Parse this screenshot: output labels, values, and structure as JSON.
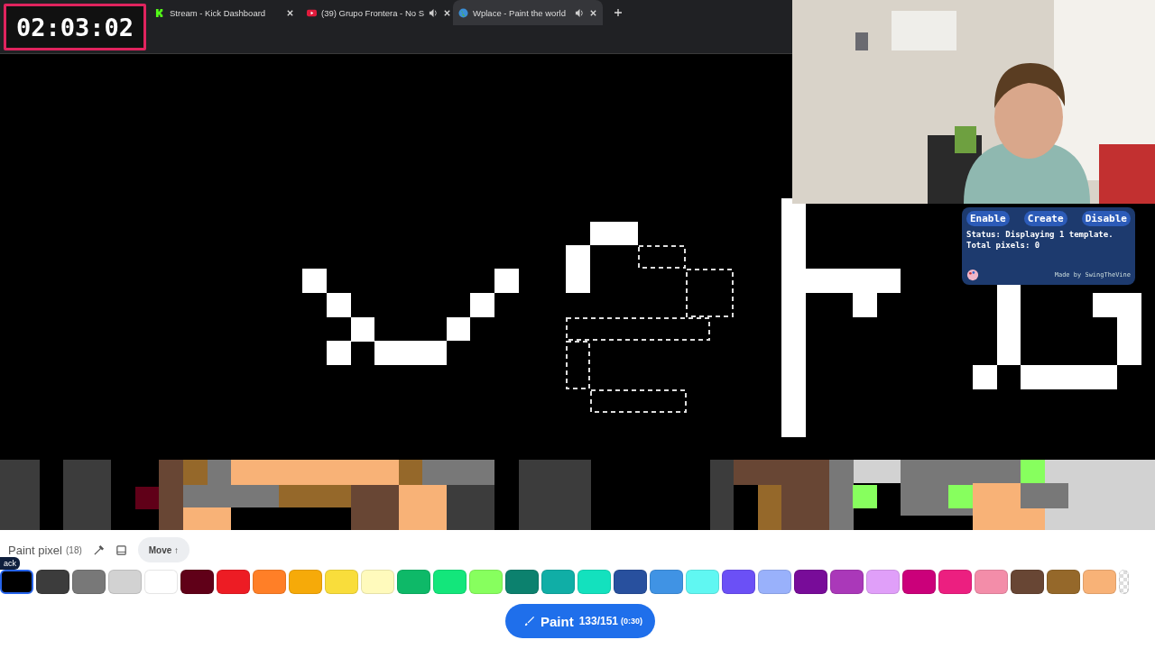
{
  "browser": {
    "tabs": [
      {
        "label": "Stream - Kick Dashboard",
        "kind": "kick",
        "audio": false,
        "selected": false
      },
      {
        "label": "(39) Grupo Frontera - No S",
        "kind": "video",
        "audio": true,
        "selected": false
      },
      {
        "label": "Wplace - Paint the world",
        "kind": "globe",
        "audio": true,
        "selected": true
      }
    ]
  },
  "timer": "02:03:02",
  "template_panel": {
    "buttons": [
      "Enable",
      "Create",
      "Disable"
    ],
    "status": "Status: Displaying 1 template.",
    "total": "Total pixels: 0",
    "credit": "Made by SwingTheVine"
  },
  "paint_bar": {
    "title": "Paint pixel",
    "count": "(18)",
    "move": "Move ↑",
    "tooltip": "ack",
    "colors": [
      {
        "color": "#000000",
        "selected": true
      },
      {
        "color": "#3c3c3c",
        "selected": false
      },
      {
        "color": "#787878",
        "selected": false
      },
      {
        "color": "#d2d2d2",
        "selected": false
      },
      {
        "color": "#ffffff",
        "selected": false
      },
      {
        "color": "#600018",
        "selected": false
      },
      {
        "color": "#ed1c24",
        "selected": false
      },
      {
        "color": "#ff7f27",
        "selected": false
      },
      {
        "color": "#f6aa09",
        "selected": false
      },
      {
        "color": "#f9dd3b",
        "selected": false
      },
      {
        "color": "#fffabc",
        "selected": false
      },
      {
        "color": "#0eb968",
        "selected": false
      },
      {
        "color": "#13e67b",
        "selected": false
      },
      {
        "color": "#87ff5e",
        "selected": false
      },
      {
        "color": "#0c816e",
        "selected": false
      },
      {
        "color": "#10aea6",
        "selected": false
      },
      {
        "color": "#13e1be",
        "selected": false
      },
      {
        "color": "#28509e",
        "selected": false
      },
      {
        "color": "#4093e4",
        "selected": false
      },
      {
        "color": "#60f7f2",
        "selected": false
      },
      {
        "color": "#6b50f6",
        "selected": false
      },
      {
        "color": "#99b1fb",
        "selected": false
      },
      {
        "color": "#780c99",
        "selected": false
      },
      {
        "color": "#aa38b9",
        "selected": false
      },
      {
        "color": "#e09ff9",
        "selected": false
      },
      {
        "color": "#cb007a",
        "selected": false
      },
      {
        "color": "#ec1f80",
        "selected": false
      },
      {
        "color": "#f38da9",
        "selected": false
      },
      {
        "color": "#684634",
        "selected": false
      },
      {
        "color": "#95682a",
        "selected": false
      },
      {
        "color": "#f8b277",
        "selected": false
      }
    ],
    "button": {
      "label": "Paint",
      "charges": "133/151",
      "cooldown": "(0:30)"
    }
  }
}
